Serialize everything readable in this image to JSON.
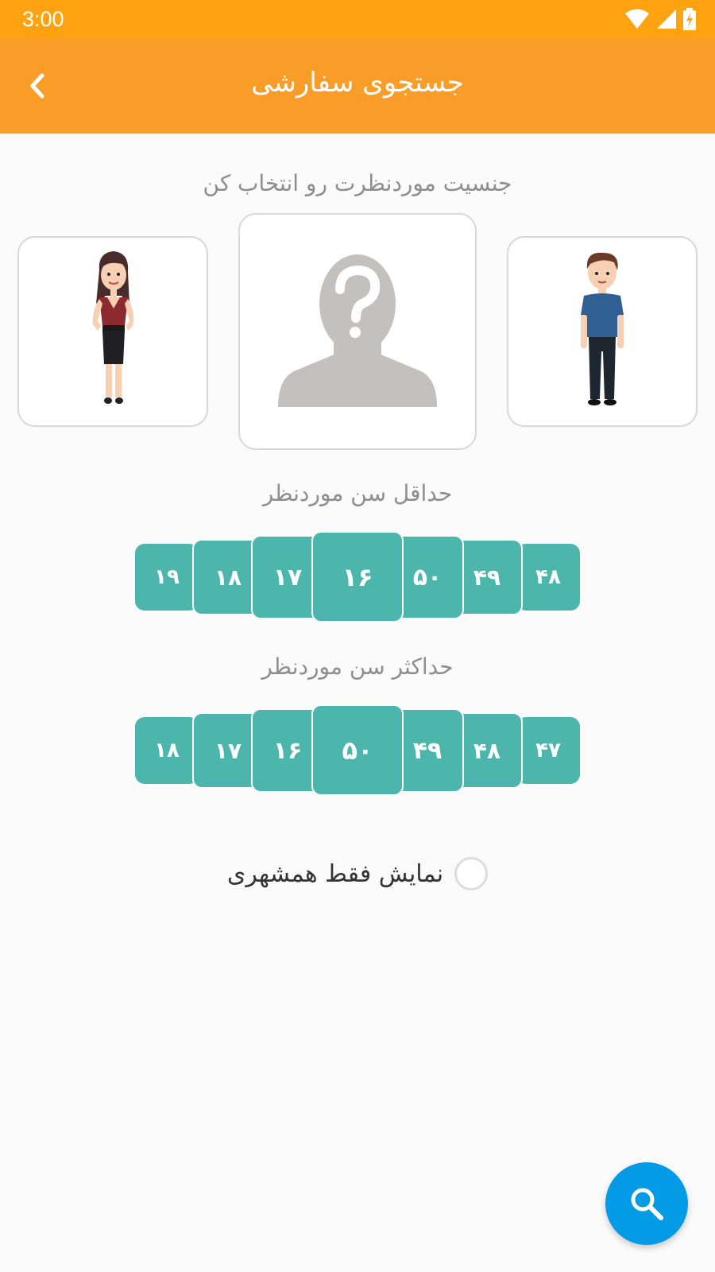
{
  "status_bar": {
    "time": "3:00",
    "icons": [
      "wifi-icon",
      "signal-icon",
      "battery-charging-icon"
    ]
  },
  "app_bar": {
    "title": "جستجوی سفارشی",
    "back_icon": "chevron-left-icon"
  },
  "gender": {
    "label": "جنسیت موردنظرت رو انتخاب کن",
    "options": [
      "female",
      "unknown",
      "male"
    ],
    "selected": "unknown"
  },
  "min_age": {
    "label": "حداقل سن موردنظر",
    "values": [
      "۱۹",
      "۱۸",
      "۱۷",
      "۱۶",
      "۵۰",
      "۴۹",
      "۴۸"
    ],
    "selected": "۱۶"
  },
  "max_age": {
    "label": "حداکثر سن موردنظر",
    "values": [
      "۱۸",
      "۱۷",
      "۱۶",
      "۵۰",
      "۴۹",
      "۴۸",
      "۴۷"
    ],
    "selected": "۵۰"
  },
  "same_city": {
    "label": "نمایش فقط همشهری",
    "checked": false
  },
  "fab": {
    "icon": "search-icon"
  },
  "colors": {
    "status_bar": "#ffa20f",
    "app_bar": "#f99d28",
    "picker": "#4db6ac",
    "fab": "#039be5"
  }
}
